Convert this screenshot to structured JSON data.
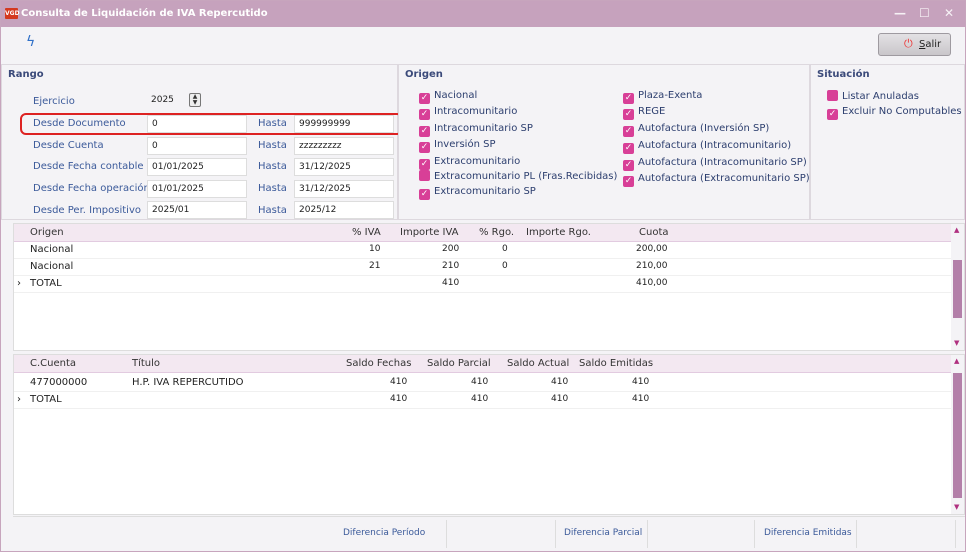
{
  "window": {
    "title": "Consulta de Liquidación de IVA Repercutido",
    "app_icon": "VGD"
  },
  "toolbar": {
    "salir_label": "alir",
    "salir_accel": "S"
  },
  "rango": {
    "title": "Rango",
    "ejercicio_label": "Ejercicio",
    "ejercicio_value": "2025",
    "hasta_label": "Hasta",
    "rows": [
      {
        "label": "Desde Documento",
        "desde": "0",
        "hasta": "999999999"
      },
      {
        "label": "Desde Cuenta",
        "desde": "0",
        "hasta": "zzzzzzzzz"
      },
      {
        "label": "Desde Fecha contable",
        "desde": "01/01/2025",
        "hasta": "31/12/2025"
      },
      {
        "label": "Desde Fecha operación",
        "desde": "01/01/2025",
        "hasta": "31/12/2025"
      },
      {
        "label": "Desde Per. Impositivo",
        "desde": "2025/01",
        "hasta": "2025/12"
      }
    ]
  },
  "origen": {
    "title": "Origen",
    "left": [
      {
        "label": "Nacional",
        "checked": true
      },
      {
        "label": "Intracomunitario",
        "checked": true
      },
      {
        "label": "Intracomunitario SP",
        "checked": true
      },
      {
        "label": "Inversión SP",
        "checked": true
      },
      {
        "label": "Extracomunitario",
        "checked": true
      },
      {
        "label": "Extracomunitario PL (Fras.Recibidas)",
        "checked": false
      },
      {
        "label": "Extracomunitario SP",
        "checked": true
      }
    ],
    "right": [
      {
        "label": "Plaza-Exenta",
        "checked": true
      },
      {
        "label": "REGE",
        "checked": true
      },
      {
        "label": "Autofactura (Inversión SP)",
        "checked": true
      },
      {
        "label": "Autofactura (Intracomunitario)",
        "checked": true
      },
      {
        "label": "Autofactura (Intracomunitario SP)",
        "checked": true
      },
      {
        "label": "Autofactura (Extracomunitario SP)",
        "checked": true
      }
    ]
  },
  "situacion": {
    "title": "Situación",
    "items": [
      {
        "label": "Listar Anuladas",
        "checked": false
      },
      {
        "label": "Excluir No Computables",
        "checked": true
      }
    ]
  },
  "grid1": {
    "headers": [
      "Origen",
      "% IVA",
      "Importe IVA",
      "% Rgo.",
      "Importe Rgo.",
      "Cuota"
    ],
    "rows": [
      {
        "origen": "Nacional",
        "iva": "10",
        "importe": "200",
        "rgo": "0",
        "cuota": "200,00"
      },
      {
        "origen": "Nacional",
        "iva": "21",
        "importe": "210",
        "rgo": "0",
        "cuota": "210,00"
      },
      {
        "origen": "TOTAL",
        "iva": "",
        "importe": "410",
        "rgo": "",
        "cuota": "410,00"
      }
    ]
  },
  "grid2": {
    "headers": [
      "C.Cuenta",
      "Título",
      "Saldo Fechas",
      "Saldo Parcial",
      "Saldo Actual",
      "Saldo Emitidas"
    ],
    "rows": [
      {
        "cuenta": "477000000",
        "titulo": "H.P. IVA REPERCUTIDO",
        "fechas": "410",
        "parcial": "410",
        "actual": "410",
        "emitidas": "410"
      },
      {
        "cuenta": "TOTAL",
        "titulo": "",
        "fechas": "410",
        "parcial": "410",
        "actual": "410",
        "emitidas": "410"
      }
    ]
  },
  "footer": {
    "dif_periodo": "Diferencia Período",
    "dif_parcial": "Diferencia Parcial",
    "dif_emitidas": "Diferencia Emitidas"
  }
}
